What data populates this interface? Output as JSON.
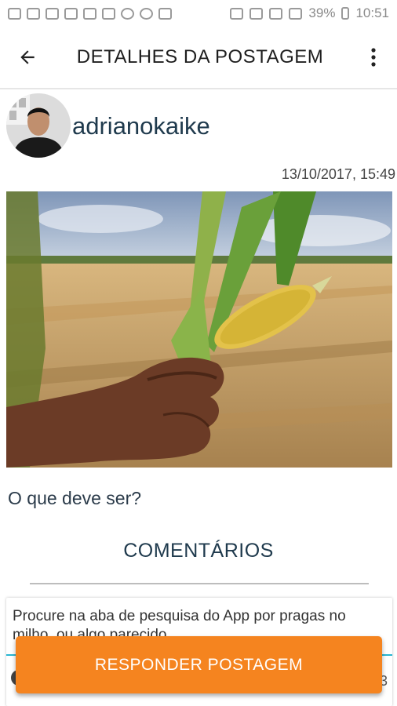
{
  "status_bar": {
    "battery": "39%",
    "time": "10:51"
  },
  "app_bar": {
    "title": "DETALHES DA POSTAGEM",
    "back_icon": "arrow-left-icon",
    "menu_icon": "more-vertical-icon"
  },
  "post": {
    "username": "adrianokaike",
    "date": "13/10/2017, 15:49",
    "text": "O que deve ser?",
    "image_description_icon": "corn-field-photo"
  },
  "comments": {
    "title": "COMENTÁRIOS",
    "items": [
      {
        "text": "Procure na aba de pesquisa do App por pragas no milho, ou algo parecido.",
        "count": "3"
      }
    ]
  },
  "actions": {
    "reply_label": "RESPONDER POSTAGEM"
  },
  "colors": {
    "accent": "#f5841f",
    "title_text": "#1f3a4d",
    "comment_line": "#29b6d2"
  }
}
